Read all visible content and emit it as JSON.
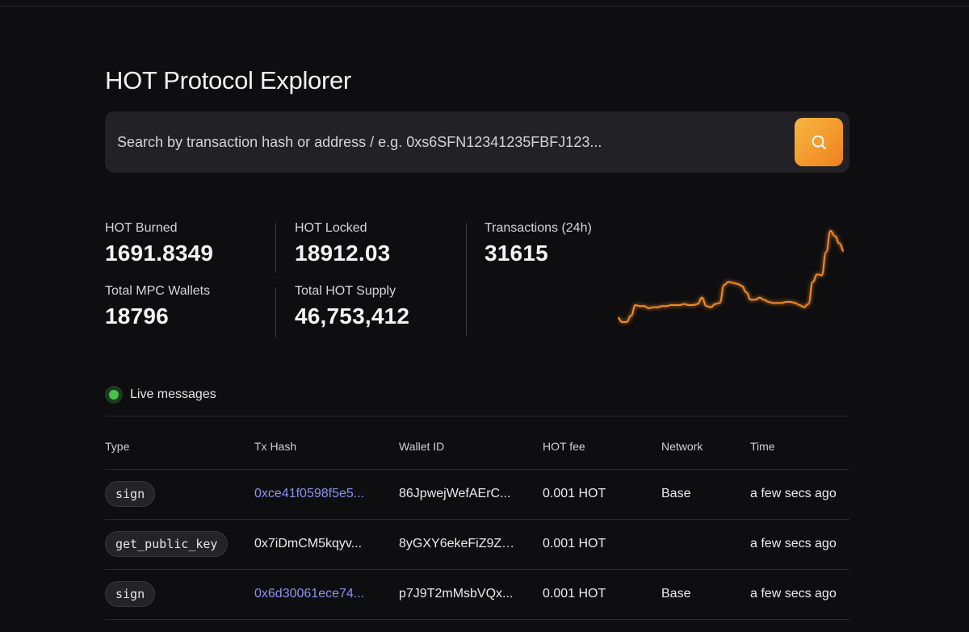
{
  "page": {
    "title": "HOT Protocol Explorer"
  },
  "search": {
    "placeholder": "Search by transaction hash or address / e.g. 0xs6SFN12341235FBFJ123...",
    "button_icon": "search-icon",
    "button_color": "#f49a2c"
  },
  "stats": {
    "hot_burned": {
      "label": "HOT Burned",
      "value": "1691.8349"
    },
    "hot_locked": {
      "label": "HOT Locked",
      "value": "18912.03"
    },
    "transactions": {
      "label": "Transactions (24h)",
      "value": "31615"
    },
    "mpc_wallets": {
      "label": "Total MPC Wallets",
      "value": "18796"
    },
    "hot_supply": {
      "label": "Total HOT Supply",
      "value": "46,753,412"
    }
  },
  "sparkline": {
    "color": "#f08a2a",
    "values": [
      4,
      0,
      0,
      6,
      16,
      15,
      15,
      13,
      14,
      14,
      15,
      15,
      16,
      16,
      16,
      17,
      16,
      16,
      17,
      23,
      15,
      14,
      17,
      18,
      35,
      38,
      37,
      36,
      34,
      28,
      21,
      21,
      23,
      21,
      19,
      18,
      18,
      18,
      19,
      19,
      18,
      16,
      14,
      17,
      38,
      45,
      44,
      66,
      86,
      81,
      74,
      67
    ]
  },
  "live": {
    "label": "Live messages",
    "status_color": "#46c24a"
  },
  "table": {
    "headers": [
      "Type",
      "Tx Hash",
      "Wallet ID",
      "HOT fee",
      "Network",
      "Time"
    ],
    "rows": [
      {
        "type": "sign",
        "tx_hash": "0xce41f0598f5e5...",
        "tx_link": true,
        "wallet_id": "86JpwejWefAErC...",
        "fee": "0.001 HOT",
        "network": "Base",
        "time": "a few secs ago"
      },
      {
        "type": "get_public_key",
        "tx_hash": "0x7iDmCM5kqyv...",
        "tx_link": false,
        "wallet_id": "8yGXY6ekeFiZ9ZG...",
        "fee": "0.001 HOT",
        "network": "",
        "time": "a few secs ago"
      },
      {
        "type": "sign",
        "tx_hash": "0x6d30061ece74...",
        "tx_link": true,
        "wallet_id": "p7J9T2mMsbVQx...",
        "fee": "0.001 HOT",
        "network": "Base",
        "time": "a few secs ago"
      }
    ]
  }
}
